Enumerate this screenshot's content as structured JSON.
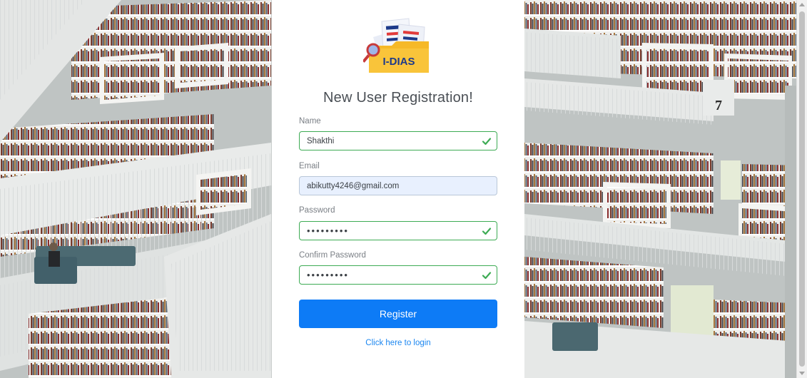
{
  "brand": {
    "logo_text": "I-DIAS"
  },
  "form": {
    "title": "New User Registration!",
    "name": {
      "label": "Name",
      "value": "Shakthi",
      "valid": true
    },
    "email": {
      "label": "Email",
      "value": "abikutty4246@gmail.com",
      "autofilled": true
    },
    "password": {
      "label": "Password",
      "value": "•••••••••",
      "valid": true
    },
    "confirm_password": {
      "label": "Confirm Password",
      "value": "•••••••••",
      "valid": true
    },
    "register_label": "Register",
    "login_link": "Click here to login"
  },
  "background": {
    "scene": "library-interior",
    "shelf_number": "7"
  },
  "colors": {
    "primary": "#0d7bf6",
    "valid": "#3dab54",
    "link": "#1b86f0",
    "autofill_bg": "#e8f0fe",
    "logo_folder": "#f6b928"
  }
}
